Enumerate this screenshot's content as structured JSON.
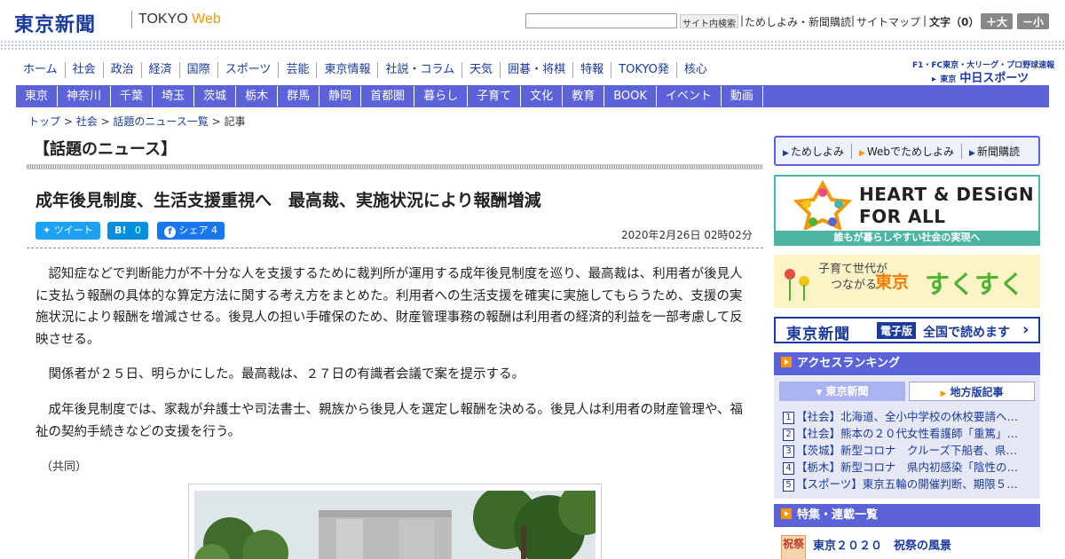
{
  "header": {
    "logo": "東京新聞",
    "logo_tokyo": "TOKYO",
    "logo_web": "Web",
    "search_button": "サイト内検索",
    "link_trial": "ためしよみ・新聞購読",
    "link_sitemap": "サイトマップ",
    "font_size_label": "文字（0）",
    "font_up": "＋大",
    "font_down": "－小"
  },
  "main_nav": [
    "ホーム",
    "社会",
    "政治",
    "経済",
    "国際",
    "スポーツ",
    "芸能",
    "東京情報",
    "社説・コラム",
    "天気",
    "囲碁・将棋",
    "特報",
    "TOKYO発",
    "核心"
  ],
  "chunichi": {
    "top": "F1・FC東京・大リーグ・プロ野球速報",
    "name_prefix": "東京",
    "name": "中日スポーツ"
  },
  "region_nav": [
    "東京",
    "神奈川",
    "千葉",
    "埼玉",
    "茨城",
    "栃木",
    "群馬",
    "静岡",
    "首都圏",
    "暮らし",
    "子育て",
    "文化",
    "教育",
    "BOOK",
    "イベント",
    "動画"
  ],
  "breadcrumb": {
    "items": [
      "トップ",
      "社会",
      "話題のニュース一覧"
    ],
    "current": "記事",
    "sep": " > "
  },
  "article": {
    "section": "【話題のニュース】",
    "headline": "成年後見制度、生活支援重視へ　最高裁、実施状況により報酬増減",
    "share_tweet": "ツイート",
    "share_hatena": "B!",
    "share_hatena_count": "0",
    "share_fb": "シェア",
    "share_fb_count": "4",
    "date": "2020年2月26日 02時02分",
    "paragraphs": [
      "　認知症などで判断能力が不十分な人を支援するために裁判所が運用する成年後見制度を巡り、最高裁は、利用者が後見人に支払う報酬の具体的な算定方法に関する考え方をまとめた。利用者への生活支援を確実に実施してもらうため、支援の実施状況により報酬を増減させる。後見人の担い手確保のため、財産管理事務の報酬は利用者の経済的利益を一部考慮して反映させる。",
      "　関係者が２５日、明らかにした。最高裁は、２７日の有識者会議で案を提示する。",
      "　成年後見制度では、家裁が弁護士や司法書士、親族から後見人を選定し報酬を決める。後見人は利用者の財産管理や、福祉の契約手続きなどの支援を行う。"
    ],
    "credit": "（共同）"
  },
  "sidebar": {
    "buttons": [
      "ためしよみ",
      "Webでためしよみ",
      "新聞購読"
    ],
    "banner1": {
      "line1": "HEART & DESiGN",
      "line2": "FOR ALL",
      "footer": "誰もが暮らしやすい社会の実現へ"
    },
    "banner2": {
      "sub1": "子育て世代が",
      "sub2": "つながる",
      "tokyo": "東京",
      "suku": "すくすく"
    },
    "banner3": {
      "logo": "東京新聞",
      "tag": "電子版",
      "text": "全国で読めます"
    },
    "ranking": {
      "title": "アクセスランキング",
      "tab_active": "東京新聞",
      "tab_inactive": "地方版記事",
      "items": [
        {
          "num": "1",
          "text": "【社会】北海道、全小中学校の休校要請へ…"
        },
        {
          "num": "2",
          "text": "【社会】熊本の２０代女性看護師「重篤」…"
        },
        {
          "num": "3",
          "text": "【茨城】新型コロナ　クルーズ下船者、県…"
        },
        {
          "num": "4",
          "text": "【栃木】新型コロナ　県内初感染「陰性の…"
        },
        {
          "num": "5",
          "text": "【スポーツ】東京五輪の開催判断、期限５…"
        }
      ]
    },
    "features": {
      "title": "特集・連載一覧",
      "thumb": "祝祭",
      "item_title": "東京２０２０　祝祭の風景"
    }
  }
}
